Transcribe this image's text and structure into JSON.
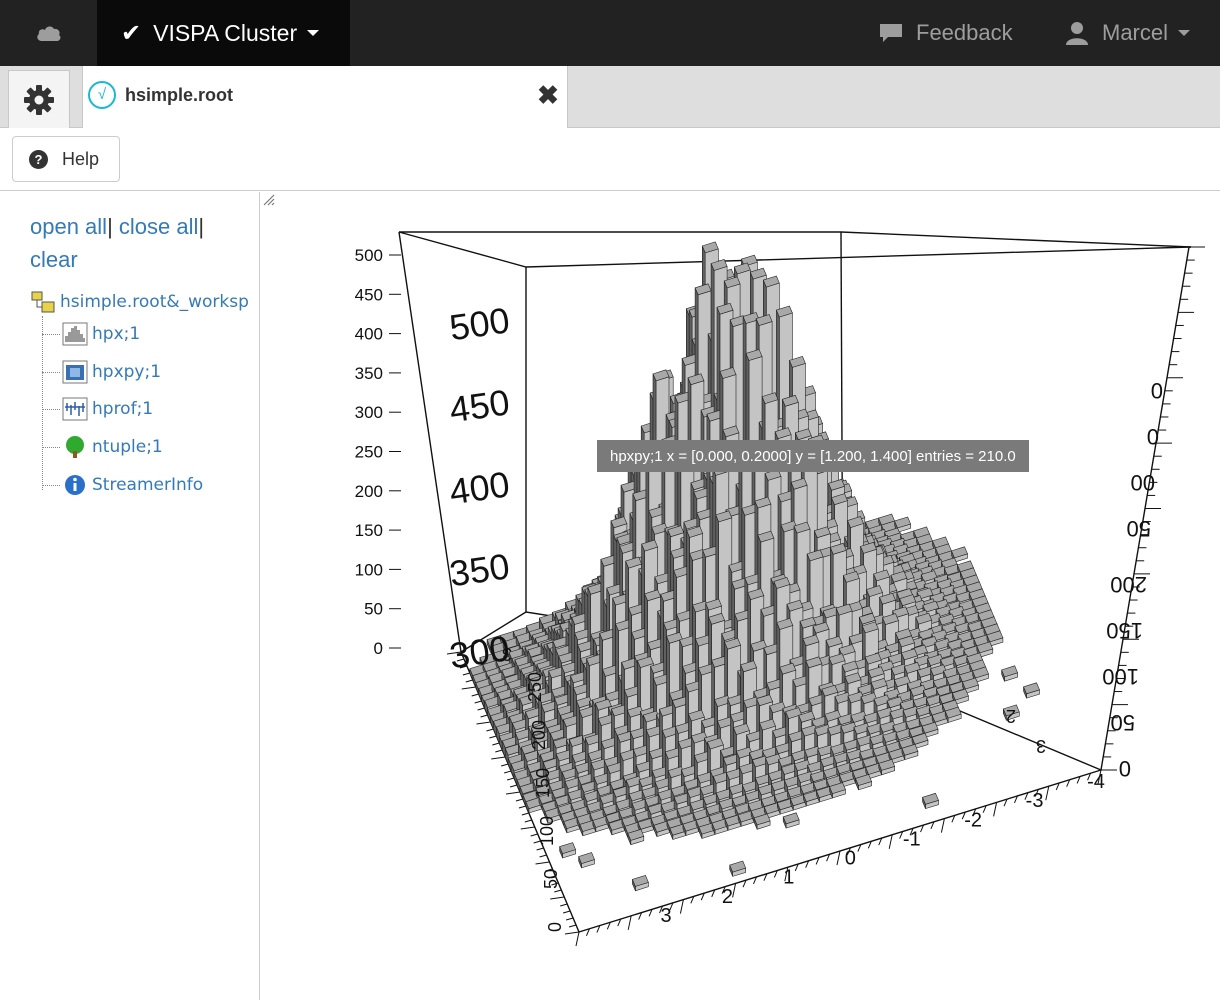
{
  "navbar": {
    "home_icon": "cloud-icon",
    "brand_check_icon": "checkmark-icon",
    "brand_label": "VISPA Cluster",
    "feedback_label": "Feedback",
    "feedback_icon": "comment-icon",
    "user_label": "Marcel",
    "user_icon": "user-icon"
  },
  "tabs": {
    "settings_icon": "gear-icon",
    "file_tab": {
      "icon": "root-sqrt-icon",
      "title": "hsimple.root",
      "close_icon": "close-icon"
    }
  },
  "toolbar": {
    "help_label": "Help",
    "help_icon": "question-circle-icon"
  },
  "sidebar": {
    "actions": {
      "open_all": "open all",
      "close_all": "close all",
      "clear": "clear",
      "separator": "|"
    },
    "tree": {
      "root": {
        "label": "hsimple.root&_worksp",
        "icon": "file-tree-icon"
      },
      "items": [
        {
          "label": "hpx;1",
          "icon": "histogram-1d-icon"
        },
        {
          "label": "hpxpy;1",
          "icon": "histogram-2d-icon"
        },
        {
          "label": "hprof;1",
          "icon": "profile-icon"
        },
        {
          "label": "ntuple;1",
          "icon": "tree-icon"
        },
        {
          "label": "StreamerInfo",
          "icon": "info-icon"
        }
      ]
    }
  },
  "plot": {
    "object": "hpxpy;1",
    "tooltip": "hpxpy;1 x = [0.000, 0.2000] y = [1.200, 1.400] entries = 210.0",
    "z_ticks_left": [
      "500",
      "450",
      "400",
      "350",
      "300",
      "250",
      "200",
      "150",
      "100",
      "50",
      "0"
    ],
    "z_ticks_zoom": [
      "500",
      "450",
      "400",
      "350",
      "300"
    ],
    "x_ticks": [
      "3",
      "2",
      "1",
      "0",
      "-1",
      "-2",
      "-3",
      "-4"
    ],
    "right_ticks": [
      "0",
      "0",
      "00",
      "50",
      "200",
      "150",
      "100",
      "50",
      "0"
    ],
    "side_ticks": [
      "3",
      "2",
      "3"
    ],
    "left_axis_ticks": [
      "250",
      "200",
      "150",
      "100",
      "50",
      "0"
    ],
    "bar_color": "#c4c4c4",
    "bar_side_color": "#606060"
  },
  "chart_data": {
    "type": "heatmap",
    "title": "",
    "object_name": "hpxpy;1",
    "rendering": "3D lego plot (mirrored view)",
    "xlabel": "",
    "ylabel": "",
    "zlabel": "",
    "x_range": [
      -4,
      4
    ],
    "y_range": [
      -4,
      4
    ],
    "z_range": [
      0,
      500
    ],
    "peak_entries_approx": 500,
    "highlighted_bin": {
      "x_range": [
        0.0,
        0.2
      ],
      "y_range": [
        1.2,
        1.4
      ],
      "entries": 210.0
    }
  }
}
